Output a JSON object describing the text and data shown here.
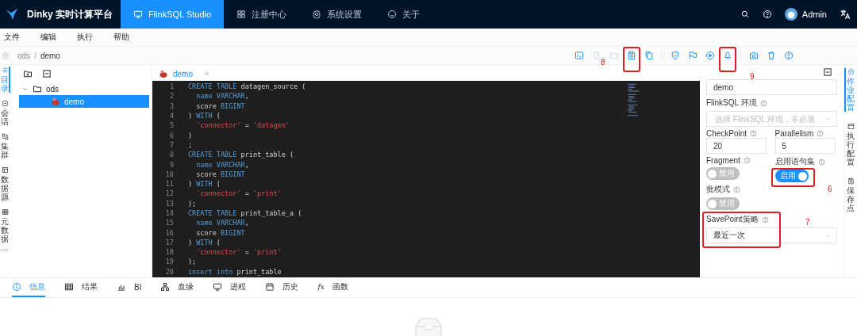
{
  "navbar": {
    "brand": "Dinky 实时计算平台",
    "user": "Admin",
    "tabs": [
      {
        "label": "FlinkSQL Studio",
        "selected": true
      },
      {
        "label": "注册中心",
        "selected": false
      },
      {
        "label": "系统设置",
        "selected": false
      },
      {
        "label": "关于",
        "selected": false
      }
    ]
  },
  "menu": [
    "文件",
    "编辑",
    "执行",
    "帮助"
  ],
  "breadcrumb": {
    "items": [
      "ods",
      "demo"
    ],
    "separator": "/"
  },
  "toolbar": [
    {
      "kind": "terminal",
      "disabled": false
    },
    {
      "kind": "file",
      "disabled": true
    },
    {
      "kind": "folder",
      "disabled": true
    },
    {
      "kind": "save",
      "disabled": false,
      "annotation": "8"
    },
    {
      "kind": "copy",
      "disabled": false
    },
    {
      "kind": "divider"
    },
    {
      "kind": "shield",
      "disabled": false
    },
    {
      "kind": "flag",
      "disabled": false
    },
    {
      "kind": "play",
      "disabled": false
    },
    {
      "kind": "bell",
      "disabled": false,
      "annotation": "9"
    },
    {
      "kind": "divider"
    },
    {
      "kind": "camera",
      "disabled": false
    },
    {
      "kind": "trash",
      "disabled": false
    },
    {
      "kind": "help",
      "disabled": false
    }
  ],
  "left_tabs": [
    {
      "label": "目录",
      "selected": true
    },
    {
      "label": "会话",
      "selected": false
    },
    {
      "label": "集群",
      "selected": false
    },
    {
      "label": "数据源",
      "selected": false
    },
    {
      "label": "元数据…",
      "selected": false
    }
  ],
  "tree": [
    {
      "label": "ods",
      "kind": "folder",
      "expanded": true,
      "selected": false,
      "children": [
        {
          "label": "demo",
          "kind": "task",
          "selected": true
        }
      ]
    }
  ],
  "editor": {
    "tab": "demo",
    "lines": [
      {
        "number": "1",
        "tokens": [
          {
            "kind": "keyword",
            "text": "CREATE TABLE"
          },
          {
            "kind": "plain",
            "text": " datagen_source ("
          }
        ]
      },
      {
        "number": "2",
        "tokens": [
          {
            "kind": "keyword",
            "text": "  name VARCHAR"
          },
          {
            "kind": "plain",
            "text": ","
          }
        ]
      },
      {
        "number": "3",
        "tokens": [
          {
            "kind": "plain",
            "text": "  score "
          },
          {
            "kind": "keyword",
            "text": "BIGINT"
          }
        ]
      },
      {
        "number": "4",
        "tokens": [
          {
            "kind": "plain",
            "text": ") "
          },
          {
            "kind": "keyword",
            "text": "WITH"
          },
          {
            "kind": "plain",
            "text": " ("
          }
        ]
      },
      {
        "number": "5",
        "tokens": [
          {
            "kind": "string",
            "text": "  'connector'"
          },
          {
            "kind": "plain",
            "text": " = "
          },
          {
            "kind": "string",
            "text": "'datagen'"
          }
        ]
      },
      {
        "number": "6",
        "tokens": [
          {
            "kind": "plain",
            "text": ")"
          }
        ]
      },
      {
        "number": "7",
        "tokens": [
          {
            "kind": "plain",
            "text": ";"
          }
        ]
      },
      {
        "number": "8",
        "tokens": [
          {
            "kind": "keyword",
            "text": "CREATE TABLE"
          },
          {
            "kind": "plain",
            "text": " print_table ("
          }
        ]
      },
      {
        "number": "9",
        "tokens": [
          {
            "kind": "keyword",
            "text": "  name VARCHAR"
          },
          {
            "kind": "plain",
            "text": ","
          }
        ]
      },
      {
        "number": "10",
        "tokens": [
          {
            "kind": "plain",
            "text": "  score "
          },
          {
            "kind": "keyword",
            "text": "BIGINT"
          }
        ]
      },
      {
        "number": "11",
        "tokens": [
          {
            "kind": "plain",
            "text": ") "
          },
          {
            "kind": "keyword",
            "text": "WITH"
          },
          {
            "kind": "plain",
            "text": " ("
          }
        ]
      },
      {
        "number": "12",
        "tokens": [
          {
            "kind": "string",
            "text": "  'connector'"
          },
          {
            "kind": "plain",
            "text": " = "
          },
          {
            "kind": "string",
            "text": "'print'"
          }
        ]
      },
      {
        "number": "13",
        "tokens": [
          {
            "kind": "plain",
            "text": ");"
          }
        ]
      },
      {
        "number": "14",
        "tokens": [
          {
            "kind": "keyword",
            "text": "CREATE TABLE"
          },
          {
            "kind": "plain",
            "text": " print_table_a ("
          }
        ]
      },
      {
        "number": "15",
        "tokens": [
          {
            "kind": "keyword",
            "text": "  name VARCHAR"
          },
          {
            "kind": "plain",
            "text": ","
          }
        ]
      },
      {
        "number": "16",
        "tokens": [
          {
            "kind": "plain",
            "text": "  score "
          },
          {
            "kind": "keyword",
            "text": "BIGINT"
          }
        ]
      },
      {
        "number": "17",
        "tokens": [
          {
            "kind": "plain",
            "text": ") "
          },
          {
            "kind": "keyword",
            "text": "WITH"
          },
          {
            "kind": "plain",
            "text": " ("
          }
        ]
      },
      {
        "number": "18",
        "tokens": [
          {
            "kind": "string",
            "text": "  'connector'"
          },
          {
            "kind": "plain",
            "text": " = "
          },
          {
            "kind": "string",
            "text": "'print'"
          }
        ]
      },
      {
        "number": "19",
        "tokens": [
          {
            "kind": "plain",
            "text": ");"
          }
        ]
      },
      {
        "number": "20",
        "tokens": [
          {
            "kind": "keyword",
            "text": "insert into"
          },
          {
            "kind": "plain",
            "text": " print_table"
          }
        ]
      }
    ]
  },
  "job_settings": {
    "name": "demo",
    "env": {
      "label": "FlinkSQL 环境",
      "placeholder": "选择 FlinkSQL 环境，非必填"
    },
    "numbers": [
      {
        "label": "CheckPoint",
        "value": "20"
      },
      {
        "label": "Parallelism",
        "value": "5"
      }
    ],
    "switches": [
      {
        "label": "Fragment",
        "on": false,
        "text": "禁用"
      },
      {
        "label": "启用语句集",
        "on": true,
        "text": "启用",
        "annotation": "6"
      },
      {
        "label": "批模式",
        "on": false,
        "text": "禁用"
      }
    ],
    "savepoint": {
      "label": "SavePoint策略",
      "value": "最近一次",
      "annotation": "7"
    }
  },
  "right_tabs": [
    {
      "label": "作业配置",
      "selected": true
    },
    {
      "label": "执行配置",
      "selected": false
    },
    {
      "label": "保存点",
      "selected": false
    }
  ],
  "bottom_tabs": [
    {
      "label": "信息",
      "selected": true
    },
    {
      "label": "结果",
      "selected": false
    },
    {
      "label": "BI",
      "selected": false
    },
    {
      "label": "血缘",
      "selected": false
    },
    {
      "label": "进程",
      "selected": false
    },
    {
      "label": "历史",
      "selected": false
    },
    {
      "label": "函数",
      "glyph": "fx",
      "selected": false
    }
  ]
}
